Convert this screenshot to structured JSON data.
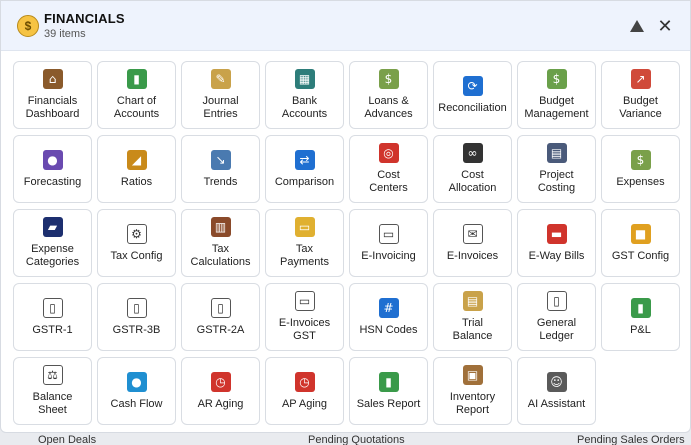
{
  "header": {
    "title": "FINANCIALS",
    "subtitle": "39 items",
    "logo": "coin-bag-icon"
  },
  "items": [
    {
      "label": "Financials\nDashboard",
      "icon": "house-icon",
      "glyph": "⌂",
      "color": "#8a5a2b"
    },
    {
      "label": "Chart of\nAccounts",
      "icon": "bar-chart-icon",
      "glyph": "▮",
      "color": "#3a9a4a"
    },
    {
      "label": "Journal\nEntries",
      "icon": "memo-icon",
      "glyph": "✎",
      "color": "#c9a24a"
    },
    {
      "label": "Bank\nAccounts",
      "icon": "bank-icon",
      "glyph": "▦",
      "color": "#2d7d7a"
    },
    {
      "label": "Loans &\nAdvances",
      "icon": "money-wings-icon",
      "glyph": "$",
      "color": "#7aa04a"
    },
    {
      "label": "Reconciliation",
      "icon": "refresh-icon",
      "glyph": "⟳",
      "color": "#1f6fd1"
    },
    {
      "label": "Budget\nManagement",
      "icon": "money-bill-icon",
      "glyph": "$",
      "color": "#6aa04a"
    },
    {
      "label": "Budget\nVariance",
      "icon": "trend-chart-icon",
      "glyph": "↗",
      "color": "#d04a3a"
    },
    {
      "label": "Forecasting",
      "icon": "crystal-ball-icon",
      "glyph": "●",
      "color": "#6a4ab0"
    },
    {
      "label": "Ratios",
      "icon": "triangle-ruler-icon",
      "glyph": "◢",
      "color": "#c98a1a"
    },
    {
      "label": "Trends",
      "icon": "line-chart-icon",
      "glyph": "↘",
      "color": "#4a7ab0"
    },
    {
      "label": "Comparison",
      "icon": "shuffle-icon",
      "glyph": "⇄",
      "color": "#1f6fd1"
    },
    {
      "label": "Cost\nCenters",
      "icon": "target-icon",
      "glyph": "◎",
      "color": "#d0342c"
    },
    {
      "label": "Cost\nAllocation",
      "icon": "link-icon",
      "glyph": "∞",
      "color": "#333333"
    },
    {
      "label": "Project\nCosting",
      "icon": "construction-icon",
      "glyph": "▤",
      "color": "#4a5a7a"
    },
    {
      "label": "Expenses",
      "icon": "money-wings-icon",
      "glyph": "$",
      "color": "#7aa04a"
    },
    {
      "label": "Expense\nCategories",
      "icon": "tag-icon",
      "glyph": "▰",
      "color": "#1d2f6f"
    },
    {
      "label": "Tax Config",
      "icon": "gear-icon",
      "glyph": "⚙",
      "color": "#ffffff"
    },
    {
      "label": "Tax\nCalculations",
      "icon": "abacus-icon",
      "glyph": "▥",
      "color": "#8a4a2a"
    },
    {
      "label": "Tax\nPayments",
      "icon": "credit-card-icon",
      "glyph": "▭",
      "color": "#e0b030"
    },
    {
      "label": "E-Invoicing",
      "icon": "receipt-icon",
      "glyph": "▭",
      "color": "#ffffff"
    },
    {
      "label": "E-Invoices",
      "icon": "envelope-icon",
      "glyph": "✉",
      "color": "#ffffff"
    },
    {
      "label": "E-Way Bills",
      "icon": "truck-icon",
      "glyph": "▬",
      "color": "#d0342c"
    },
    {
      "label": "GST Config",
      "icon": "lock-icon",
      "glyph": "■",
      "color": "#e0a020"
    },
    {
      "label": "GSTR-1",
      "icon": "document-icon",
      "glyph": "▯",
      "color": "#ffffff"
    },
    {
      "label": "GSTR-3B",
      "icon": "document-icon",
      "glyph": "▯",
      "color": "#ffffff"
    },
    {
      "label": "GSTR-2A",
      "icon": "document-icon",
      "glyph": "▯",
      "color": "#ffffff"
    },
    {
      "label": "E-Invoices\nGST",
      "icon": "receipt-icon",
      "glyph": "▭",
      "color": "#ffffff"
    },
    {
      "label": "HSN Codes",
      "icon": "number-keypad-icon",
      "glyph": "#",
      "color": "#1f6fd1"
    },
    {
      "label": "Trial\nBalance",
      "icon": "clipboard-icon",
      "glyph": "▤",
      "color": "#c9a24a"
    },
    {
      "label": "General\nLedger",
      "icon": "open-book-icon",
      "glyph": "▯",
      "color": "#ffffff"
    },
    {
      "label": "P&L",
      "icon": "bar-chart-icon",
      "glyph": "▮",
      "color": "#3a9a4a"
    },
    {
      "label": "Balance\nSheet",
      "icon": "scales-icon",
      "glyph": "⚖",
      "color": "#ffffff"
    },
    {
      "label": "Cash Flow",
      "icon": "droplet-icon",
      "glyph": "●",
      "color": "#1f8fd1"
    },
    {
      "label": "AR Aging",
      "icon": "alarm-clock-icon",
      "glyph": "◷",
      "color": "#d0342c"
    },
    {
      "label": "AP Aging",
      "icon": "alarm-clock-icon",
      "glyph": "◷",
      "color": "#d0342c"
    },
    {
      "label": "Sales Report",
      "icon": "bar-chart-icon",
      "glyph": "▮",
      "color": "#3a9a4a"
    },
    {
      "label": "Inventory\nReport",
      "icon": "package-icon",
      "glyph": "▣",
      "color": "#a0703a"
    },
    {
      "label": "AI Assistant",
      "icon": "robot-face-icon",
      "glyph": "☺",
      "color": "#5a5a5a"
    }
  ],
  "bottom_bar": [
    "Open Deals",
    "Pending Quotations",
    "Pending Sales Orders"
  ]
}
